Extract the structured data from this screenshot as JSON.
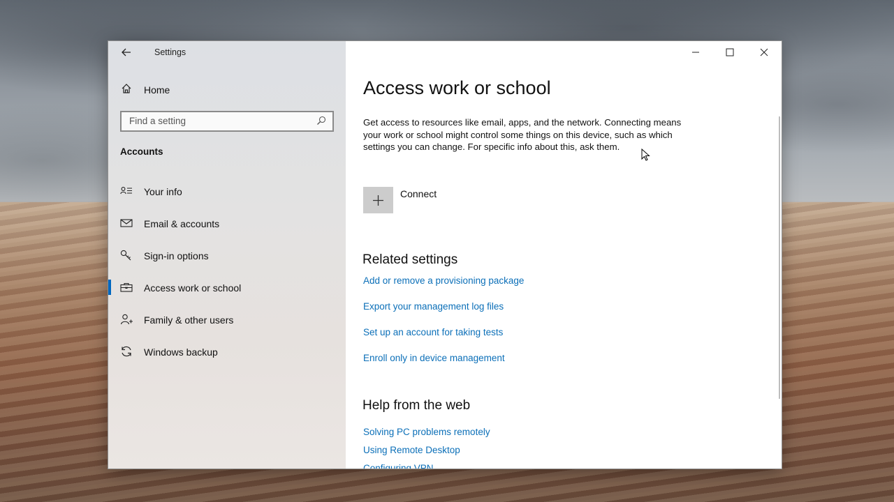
{
  "window": {
    "title": "Settings",
    "back_icon": "back-arrow-icon"
  },
  "sidebar": {
    "home_label": "Home",
    "search_placeholder": "Find a setting",
    "section_title": "Accounts",
    "items": [
      {
        "label": "Your info",
        "icon": "person-card-icon",
        "active": false
      },
      {
        "label": "Email & accounts",
        "icon": "mail-icon",
        "active": false
      },
      {
        "label": "Sign-in options",
        "icon": "key-icon",
        "active": false
      },
      {
        "label": "Access work or school",
        "icon": "briefcase-icon",
        "active": true
      },
      {
        "label": "Family & other users",
        "icon": "person-add-icon",
        "active": false
      },
      {
        "label": "Windows backup",
        "icon": "sync-icon",
        "active": false
      }
    ]
  },
  "main": {
    "title": "Access work or school",
    "description": "Get access to resources like email, apps, and the network. Connecting means your work or school might control some things on this device, such as which settings you can change. For specific info about this, ask them.",
    "connect_label": "Connect",
    "related_title": "Related settings",
    "related_links": [
      "Add or remove a provisioning package",
      "Export your management log files",
      "Set up an account for taking tests",
      "Enroll only in device management"
    ],
    "help_title": "Help from the web",
    "help_links": [
      "Solving PC problems remotely",
      "Using Remote Desktop",
      "Configuring VPN"
    ]
  },
  "colors": {
    "accent": "#0067c0",
    "link": "#0b6fb8"
  }
}
